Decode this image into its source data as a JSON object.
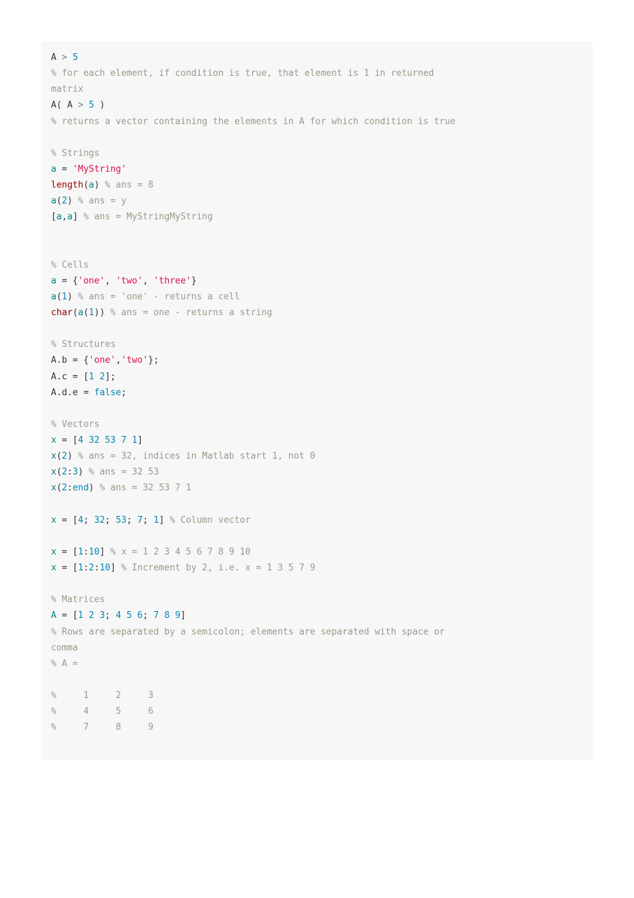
{
  "code": {
    "lines": [
      [
        {
          "t": "A ",
          "c": "t"
        },
        {
          "t": ">",
          "c": "op"
        },
        {
          "t": " ",
          "c": "t"
        },
        {
          "t": "5",
          "c": "nm"
        }
      ],
      [
        {
          "t": "% for each element, if condition is true, that element is 1 in returned",
          "c": "cm"
        }
      ],
      [
        {
          "t": "matrix",
          "c": "cm"
        }
      ],
      [
        {
          "t": "A( A ",
          "c": "t"
        },
        {
          "t": ">",
          "c": "op"
        },
        {
          "t": " ",
          "c": "t"
        },
        {
          "t": "5",
          "c": "nm"
        },
        {
          "t": " )",
          "c": "t"
        }
      ],
      [
        {
          "t": "% returns a vector containing the elements in A for which condition is true",
          "c": "cm"
        }
      ],
      [],
      [
        {
          "t": "% Strings",
          "c": "cm"
        }
      ],
      [
        {
          "t": "a",
          "c": "id"
        },
        {
          "t": " = ",
          "c": "t"
        },
        {
          "t": "'MyString'",
          "c": "st"
        }
      ],
      [
        {
          "t": "length",
          "c": "fn"
        },
        {
          "t": "(",
          "c": "t"
        },
        {
          "t": "a",
          "c": "id"
        },
        {
          "t": ") ",
          "c": "t"
        },
        {
          "t": "% ans = 8",
          "c": "cm"
        }
      ],
      [
        {
          "t": "a",
          "c": "id"
        },
        {
          "t": "(",
          "c": "t"
        },
        {
          "t": "2",
          "c": "nm"
        },
        {
          "t": ") ",
          "c": "t"
        },
        {
          "t": "% ans = y",
          "c": "cm"
        }
      ],
      [
        {
          "t": "[",
          "c": "t"
        },
        {
          "t": "a",
          "c": "id"
        },
        {
          "t": ",",
          "c": "t"
        },
        {
          "t": "a",
          "c": "id"
        },
        {
          "t": "] ",
          "c": "t"
        },
        {
          "t": "% ans = MyStringMyString",
          "c": "cm"
        }
      ],
      [],
      [],
      [
        {
          "t": "% Cells",
          "c": "cm"
        }
      ],
      [
        {
          "t": "a",
          "c": "id"
        },
        {
          "t": " = {",
          "c": "t"
        },
        {
          "t": "'one'",
          "c": "st"
        },
        {
          "t": ", ",
          "c": "t"
        },
        {
          "t": "'two'",
          "c": "st"
        },
        {
          "t": ", ",
          "c": "t"
        },
        {
          "t": "'three'",
          "c": "st"
        },
        {
          "t": "}",
          "c": "t"
        }
      ],
      [
        {
          "t": "a",
          "c": "id"
        },
        {
          "t": "(",
          "c": "t"
        },
        {
          "t": "1",
          "c": "nm"
        },
        {
          "t": ") ",
          "c": "t"
        },
        {
          "t": "% ans = 'one' - returns a cell",
          "c": "cm"
        }
      ],
      [
        {
          "t": "char",
          "c": "fn"
        },
        {
          "t": "(",
          "c": "t"
        },
        {
          "t": "a",
          "c": "id"
        },
        {
          "t": "(",
          "c": "t"
        },
        {
          "t": "1",
          "c": "nm"
        },
        {
          "t": ")) ",
          "c": "t"
        },
        {
          "t": "% ans = one - returns a string",
          "c": "cm"
        }
      ],
      [],
      [
        {
          "t": "% Structures",
          "c": "cm"
        }
      ],
      [
        {
          "t": "A.b = {",
          "c": "t"
        },
        {
          "t": "'one'",
          "c": "st"
        },
        {
          "t": ",",
          "c": "t"
        },
        {
          "t": "'two'",
          "c": "st"
        },
        {
          "t": "};",
          "c": "t"
        }
      ],
      [
        {
          "t": "A.c = [",
          "c": "t"
        },
        {
          "t": "1",
          "c": "nm"
        },
        {
          "t": " ",
          "c": "t"
        },
        {
          "t": "2",
          "c": "nm"
        },
        {
          "t": "];",
          "c": "t"
        }
      ],
      [
        {
          "t": "A.d.e = ",
          "c": "t"
        },
        {
          "t": "false",
          "c": "kw"
        },
        {
          "t": ";",
          "c": "t"
        }
      ],
      [],
      [
        {
          "t": "% Vectors",
          "c": "cm"
        }
      ],
      [
        {
          "t": "x",
          "c": "id"
        },
        {
          "t": " = [",
          "c": "t"
        },
        {
          "t": "4",
          "c": "nm"
        },
        {
          "t": " ",
          "c": "t"
        },
        {
          "t": "32",
          "c": "nm"
        },
        {
          "t": " ",
          "c": "t"
        },
        {
          "t": "53",
          "c": "nm"
        },
        {
          "t": " ",
          "c": "t"
        },
        {
          "t": "7",
          "c": "nm"
        },
        {
          "t": " ",
          "c": "t"
        },
        {
          "t": "1",
          "c": "nm"
        },
        {
          "t": "]",
          "c": "t"
        }
      ],
      [
        {
          "t": "x",
          "c": "id"
        },
        {
          "t": "(",
          "c": "t"
        },
        {
          "t": "2",
          "c": "nm"
        },
        {
          "t": ") ",
          "c": "t"
        },
        {
          "t": "% ans = 32, indices in Matlab start 1, not 0",
          "c": "cm"
        }
      ],
      [
        {
          "t": "x",
          "c": "id"
        },
        {
          "t": "(",
          "c": "t"
        },
        {
          "t": "2",
          "c": "nm"
        },
        {
          "t": ":",
          "c": "t"
        },
        {
          "t": "3",
          "c": "nm"
        },
        {
          "t": ") ",
          "c": "t"
        },
        {
          "t": "% ans = 32 53",
          "c": "cm"
        }
      ],
      [
        {
          "t": "x",
          "c": "id"
        },
        {
          "t": "(",
          "c": "t"
        },
        {
          "t": "2",
          "c": "nm"
        },
        {
          "t": ":",
          "c": "t"
        },
        {
          "t": "end",
          "c": "kw"
        },
        {
          "t": ") ",
          "c": "t"
        },
        {
          "t": "% ans = 32 53 7 1",
          "c": "cm"
        }
      ],
      [],
      [
        {
          "t": "x",
          "c": "id"
        },
        {
          "t": " = [",
          "c": "t"
        },
        {
          "t": "4",
          "c": "nm"
        },
        {
          "t": "; ",
          "c": "t"
        },
        {
          "t": "32",
          "c": "nm"
        },
        {
          "t": "; ",
          "c": "t"
        },
        {
          "t": "53",
          "c": "nm"
        },
        {
          "t": "; ",
          "c": "t"
        },
        {
          "t": "7",
          "c": "nm"
        },
        {
          "t": "; ",
          "c": "t"
        },
        {
          "t": "1",
          "c": "nm"
        },
        {
          "t": "] ",
          "c": "t"
        },
        {
          "t": "% Column vector",
          "c": "cm"
        }
      ],
      [],
      [
        {
          "t": "x",
          "c": "id"
        },
        {
          "t": " = [",
          "c": "t"
        },
        {
          "t": "1",
          "c": "nm"
        },
        {
          "t": ":",
          "c": "t"
        },
        {
          "t": "10",
          "c": "nm"
        },
        {
          "t": "] ",
          "c": "t"
        },
        {
          "t": "% x = 1 2 3 4 5 6 7 8 9 10",
          "c": "cm"
        }
      ],
      [
        {
          "t": "x",
          "c": "id"
        },
        {
          "t": " = [",
          "c": "t"
        },
        {
          "t": "1",
          "c": "nm"
        },
        {
          "t": ":",
          "c": "t"
        },
        {
          "t": "2",
          "c": "nm"
        },
        {
          "t": ":",
          "c": "t"
        },
        {
          "t": "10",
          "c": "nm"
        },
        {
          "t": "] ",
          "c": "t"
        },
        {
          "t": "% Increment by 2, i.e. x = 1 3 5 7 9",
          "c": "cm"
        }
      ],
      [],
      [
        {
          "t": "% Matrices",
          "c": "cm"
        }
      ],
      [
        {
          "t": "A",
          "c": "id"
        },
        {
          "t": " = [",
          "c": "t"
        },
        {
          "t": "1",
          "c": "nm"
        },
        {
          "t": " ",
          "c": "t"
        },
        {
          "t": "2",
          "c": "nm"
        },
        {
          "t": " ",
          "c": "t"
        },
        {
          "t": "3",
          "c": "nm"
        },
        {
          "t": "; ",
          "c": "t"
        },
        {
          "t": "4",
          "c": "nm"
        },
        {
          "t": " ",
          "c": "t"
        },
        {
          "t": "5",
          "c": "nm"
        },
        {
          "t": " ",
          "c": "t"
        },
        {
          "t": "6",
          "c": "nm"
        },
        {
          "t": "; ",
          "c": "t"
        },
        {
          "t": "7",
          "c": "nm"
        },
        {
          "t": " ",
          "c": "t"
        },
        {
          "t": "8",
          "c": "nm"
        },
        {
          "t": " ",
          "c": "t"
        },
        {
          "t": "9",
          "c": "nm"
        },
        {
          "t": "]",
          "c": "t"
        }
      ],
      [
        {
          "t": "% Rows are separated by a semicolon; elements are separated with space or",
          "c": "cm"
        }
      ],
      [
        {
          "t": "comma",
          "c": "cm"
        }
      ],
      [
        {
          "t": "% A =",
          "c": "cm"
        }
      ],
      [],
      [
        {
          "t": "%     1     2     3",
          "c": "cm"
        }
      ],
      [
        {
          "t": "%     4     5     6",
          "c": "cm"
        }
      ],
      [
        {
          "t": "%     7     8     9",
          "c": "cm"
        }
      ],
      []
    ]
  }
}
